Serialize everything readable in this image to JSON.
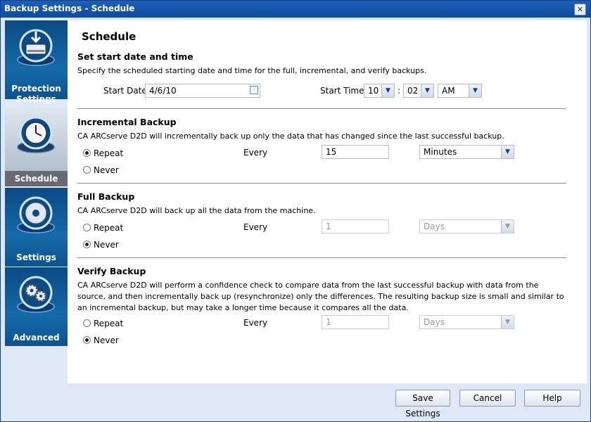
{
  "window": {
    "title": "Backup Settings - Schedule",
    "close_glyph": "✕"
  },
  "sidebar": {
    "items": [
      {
        "label": "Protection Settings",
        "icon": "hard-drive-icon",
        "active": false
      },
      {
        "label": "Schedule",
        "icon": "clock-icon",
        "active": true
      },
      {
        "label": "Settings",
        "icon": "disc-icon",
        "active": false
      },
      {
        "label": "Advanced",
        "icon": "gears-icon",
        "active": false
      }
    ]
  },
  "schedule": {
    "title": "Schedule",
    "start": {
      "heading": "Set start date and time",
      "description": "Specify the scheduled starting date and time for the full, incremental, and verify backups.",
      "date_label": "Start Date",
      "date_value": "4/6/10",
      "time_label": "Start Time",
      "hour": "10",
      "separator": ":",
      "minute": "02",
      "ampm": "AM"
    },
    "incremental": {
      "heading": "Incremental Backup",
      "description": "CA ARCserve D2D will incrementally back up only the data that has changed since the last successful backup.",
      "repeat_label": "Repeat",
      "never_label": "Never",
      "selected": "repeat",
      "every_label": "Every",
      "every_value": "15",
      "unit": "Minutes"
    },
    "full": {
      "heading": "Full Backup",
      "description": "CA ARCserve D2D will back up all the data from the machine.",
      "repeat_label": "Repeat",
      "never_label": "Never",
      "selected": "never",
      "every_label": "Every",
      "every_value": "1",
      "unit": "Days"
    },
    "verify": {
      "heading": "Verify Backup",
      "description_lines": [
        "CA ARCserve D2D will perform a confidence check to compare data from the last successful backup with data from the",
        "source, and then incrementally back up (resynchronize) only the differences. The resulting backup size is small and similar to",
        "an incremental backup, but may take a longer time because it compares all the data."
      ],
      "repeat_label": "Repeat",
      "never_label": "Never",
      "selected": "never",
      "every_label": "Every",
      "every_value": "1",
      "unit": "Days"
    }
  },
  "footer": {
    "save_label": "Save Settings",
    "cancel_label": "Cancel",
    "help_label": "Help"
  },
  "colors": {
    "title_bar": "#0f4a9c",
    "nav_blue": "#0d5390",
    "nav_active": "#676a70",
    "panel_bg": "#dfe8f6"
  }
}
